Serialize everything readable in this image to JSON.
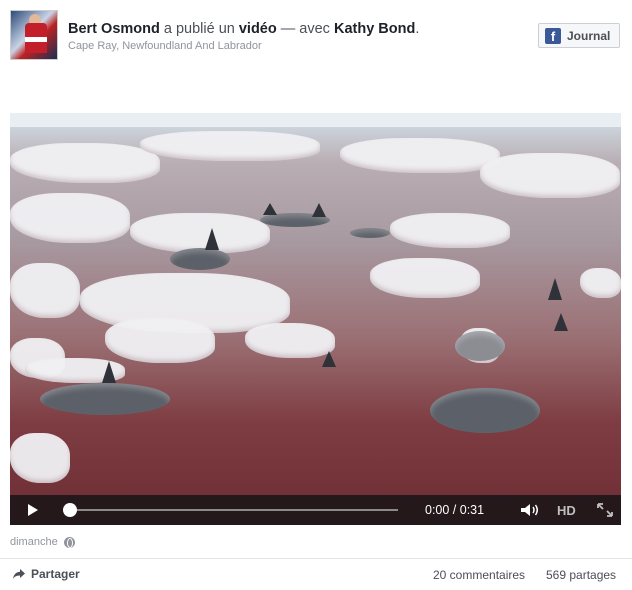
{
  "post": {
    "author": "Bert Osmond",
    "action_pre": "a publié un",
    "object": "vidéo",
    "action_post": "— avec",
    "tagged": "Kathy Bond",
    "end": ".",
    "location": "Cape Ray, Newfoundland And Labrador",
    "journal_label": "Journal",
    "fb_glyph": "f"
  },
  "video": {
    "time": "0:00 / 0:31",
    "hd_label": "HD",
    "progress_fraction": 0.0
  },
  "meta": {
    "timestamp": "dimanche"
  },
  "actions": {
    "share_label": "Partager",
    "comments": "20 commentaires",
    "shares": "569 partages"
  },
  "colors": {
    "facebook_blue": "#3b5998",
    "text_dark": "#1d2129",
    "text_gray": "#90949c"
  }
}
